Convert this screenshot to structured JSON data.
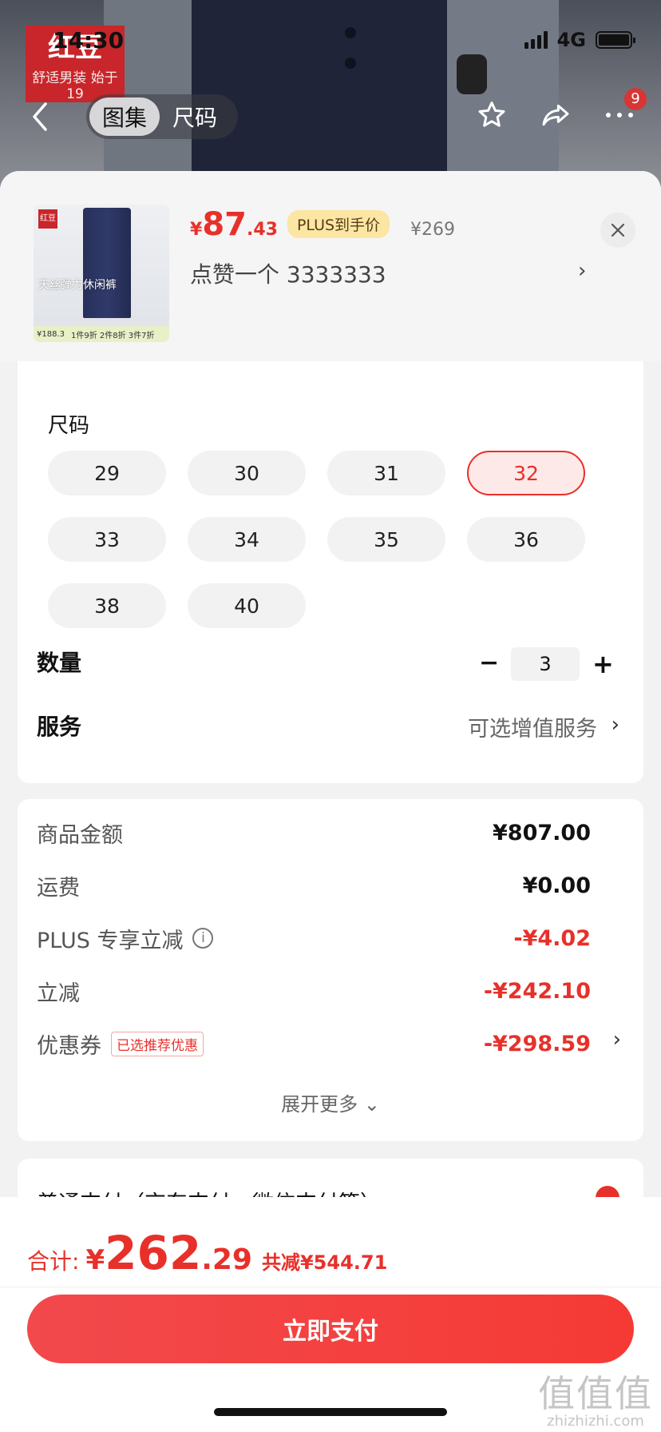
{
  "status_bar": {
    "time": "14:30",
    "network": "4G"
  },
  "header": {
    "tabs": [
      {
        "label": "图集",
        "active": true
      },
      {
        "label": "尺码",
        "active": false
      }
    ],
    "cart_badge": "9",
    "background_logo": {
      "brand": "红豆",
      "tagline": "舒适男装 始于19"
    }
  },
  "product": {
    "thumbnail": {
      "logo": "红豆",
      "caption_line1": "天丝弹力休闲裤",
      "promo_price": "¥188.3",
      "promo_text": "1件9折 2件8折 3件7折"
    },
    "price_symbol": "¥",
    "price_integer": "87",
    "price_decimal": ".43",
    "plus_tag": "PLUS到手价",
    "original_price": "¥269",
    "variant_text": "点赞一个  3333333"
  },
  "sku": {
    "size_title": "尺码",
    "sizes": [
      "29",
      "30",
      "31",
      "32",
      "33",
      "34",
      "35",
      "36",
      "38",
      "40"
    ],
    "selected_size": "32",
    "quantity_label": "数量",
    "quantity": "3",
    "service_label": "服务",
    "service_value": "可选增值服务"
  },
  "pricing": {
    "rows": [
      {
        "label": "商品金额",
        "value": "¥807.00",
        "red": false
      },
      {
        "label": "运费",
        "value": "¥0.00",
        "red": false
      },
      {
        "label": "PLUS 专享立减",
        "value": "-¥4.02",
        "red": true
      },
      {
        "label": "立减",
        "value": "-¥242.10",
        "red": true
      },
      {
        "label": "优惠券",
        "value": "-¥298.59",
        "red": true
      }
    ],
    "coupon_tag": "已选推荐优惠",
    "expand_label": "展开更多"
  },
  "payment": {
    "method_text": "普通支付（京东支付、微信支付等）"
  },
  "footer": {
    "total_label": "合计:",
    "total_symbol": "¥",
    "total_integer": "262",
    "total_decimal": ".29",
    "total_saved": "共减¥544.71",
    "pay_button": "立即支付"
  },
  "watermark": {
    "big": "值值值",
    "small": "zhizhizhi.com"
  },
  "colors": {
    "accent": "#e8302a",
    "plus_bg": "#fbe7a3"
  }
}
